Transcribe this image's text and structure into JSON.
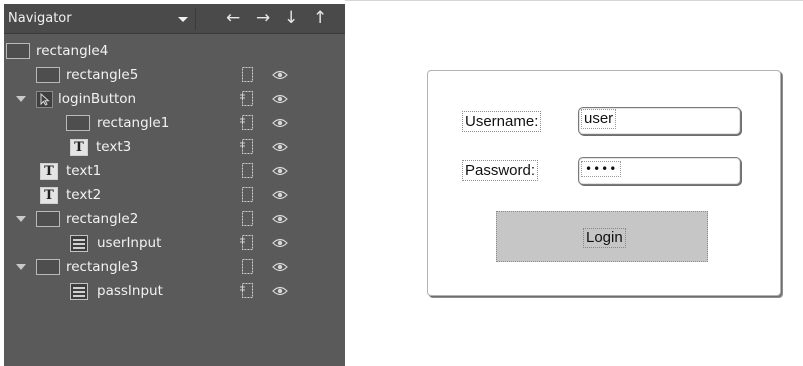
{
  "navigator": {
    "title": "Navigator",
    "arrows": {
      "left": "←",
      "right": "→",
      "down": "↓",
      "up": "↑"
    },
    "items": [
      {
        "label": "rectangle4",
        "type": "rectangle"
      },
      {
        "label": "rectangle5",
        "type": "rectangle"
      },
      {
        "label": "loginButton",
        "type": "button",
        "expanded": true
      },
      {
        "label": "rectangle1",
        "type": "rectangle"
      },
      {
        "label": "text3",
        "type": "text"
      },
      {
        "label": "text1",
        "type": "text"
      },
      {
        "label": "text2",
        "type": "text"
      },
      {
        "label": "rectangle2",
        "type": "rectangle",
        "expanded": true
      },
      {
        "label": "userInput",
        "type": "input"
      },
      {
        "label": "rectangle3",
        "type": "rectangle",
        "expanded": true
      },
      {
        "label": "passInput",
        "type": "input"
      }
    ]
  },
  "form": {
    "username_label": "Username:",
    "username_value": "user",
    "password_label": "Password:",
    "password_value": "••••",
    "login_label": "Login"
  },
  "colors": {
    "panel_bg": "#5a5a5a",
    "panel_header_bg": "#4a4a4a",
    "button_fill": "#c6c6c6"
  }
}
